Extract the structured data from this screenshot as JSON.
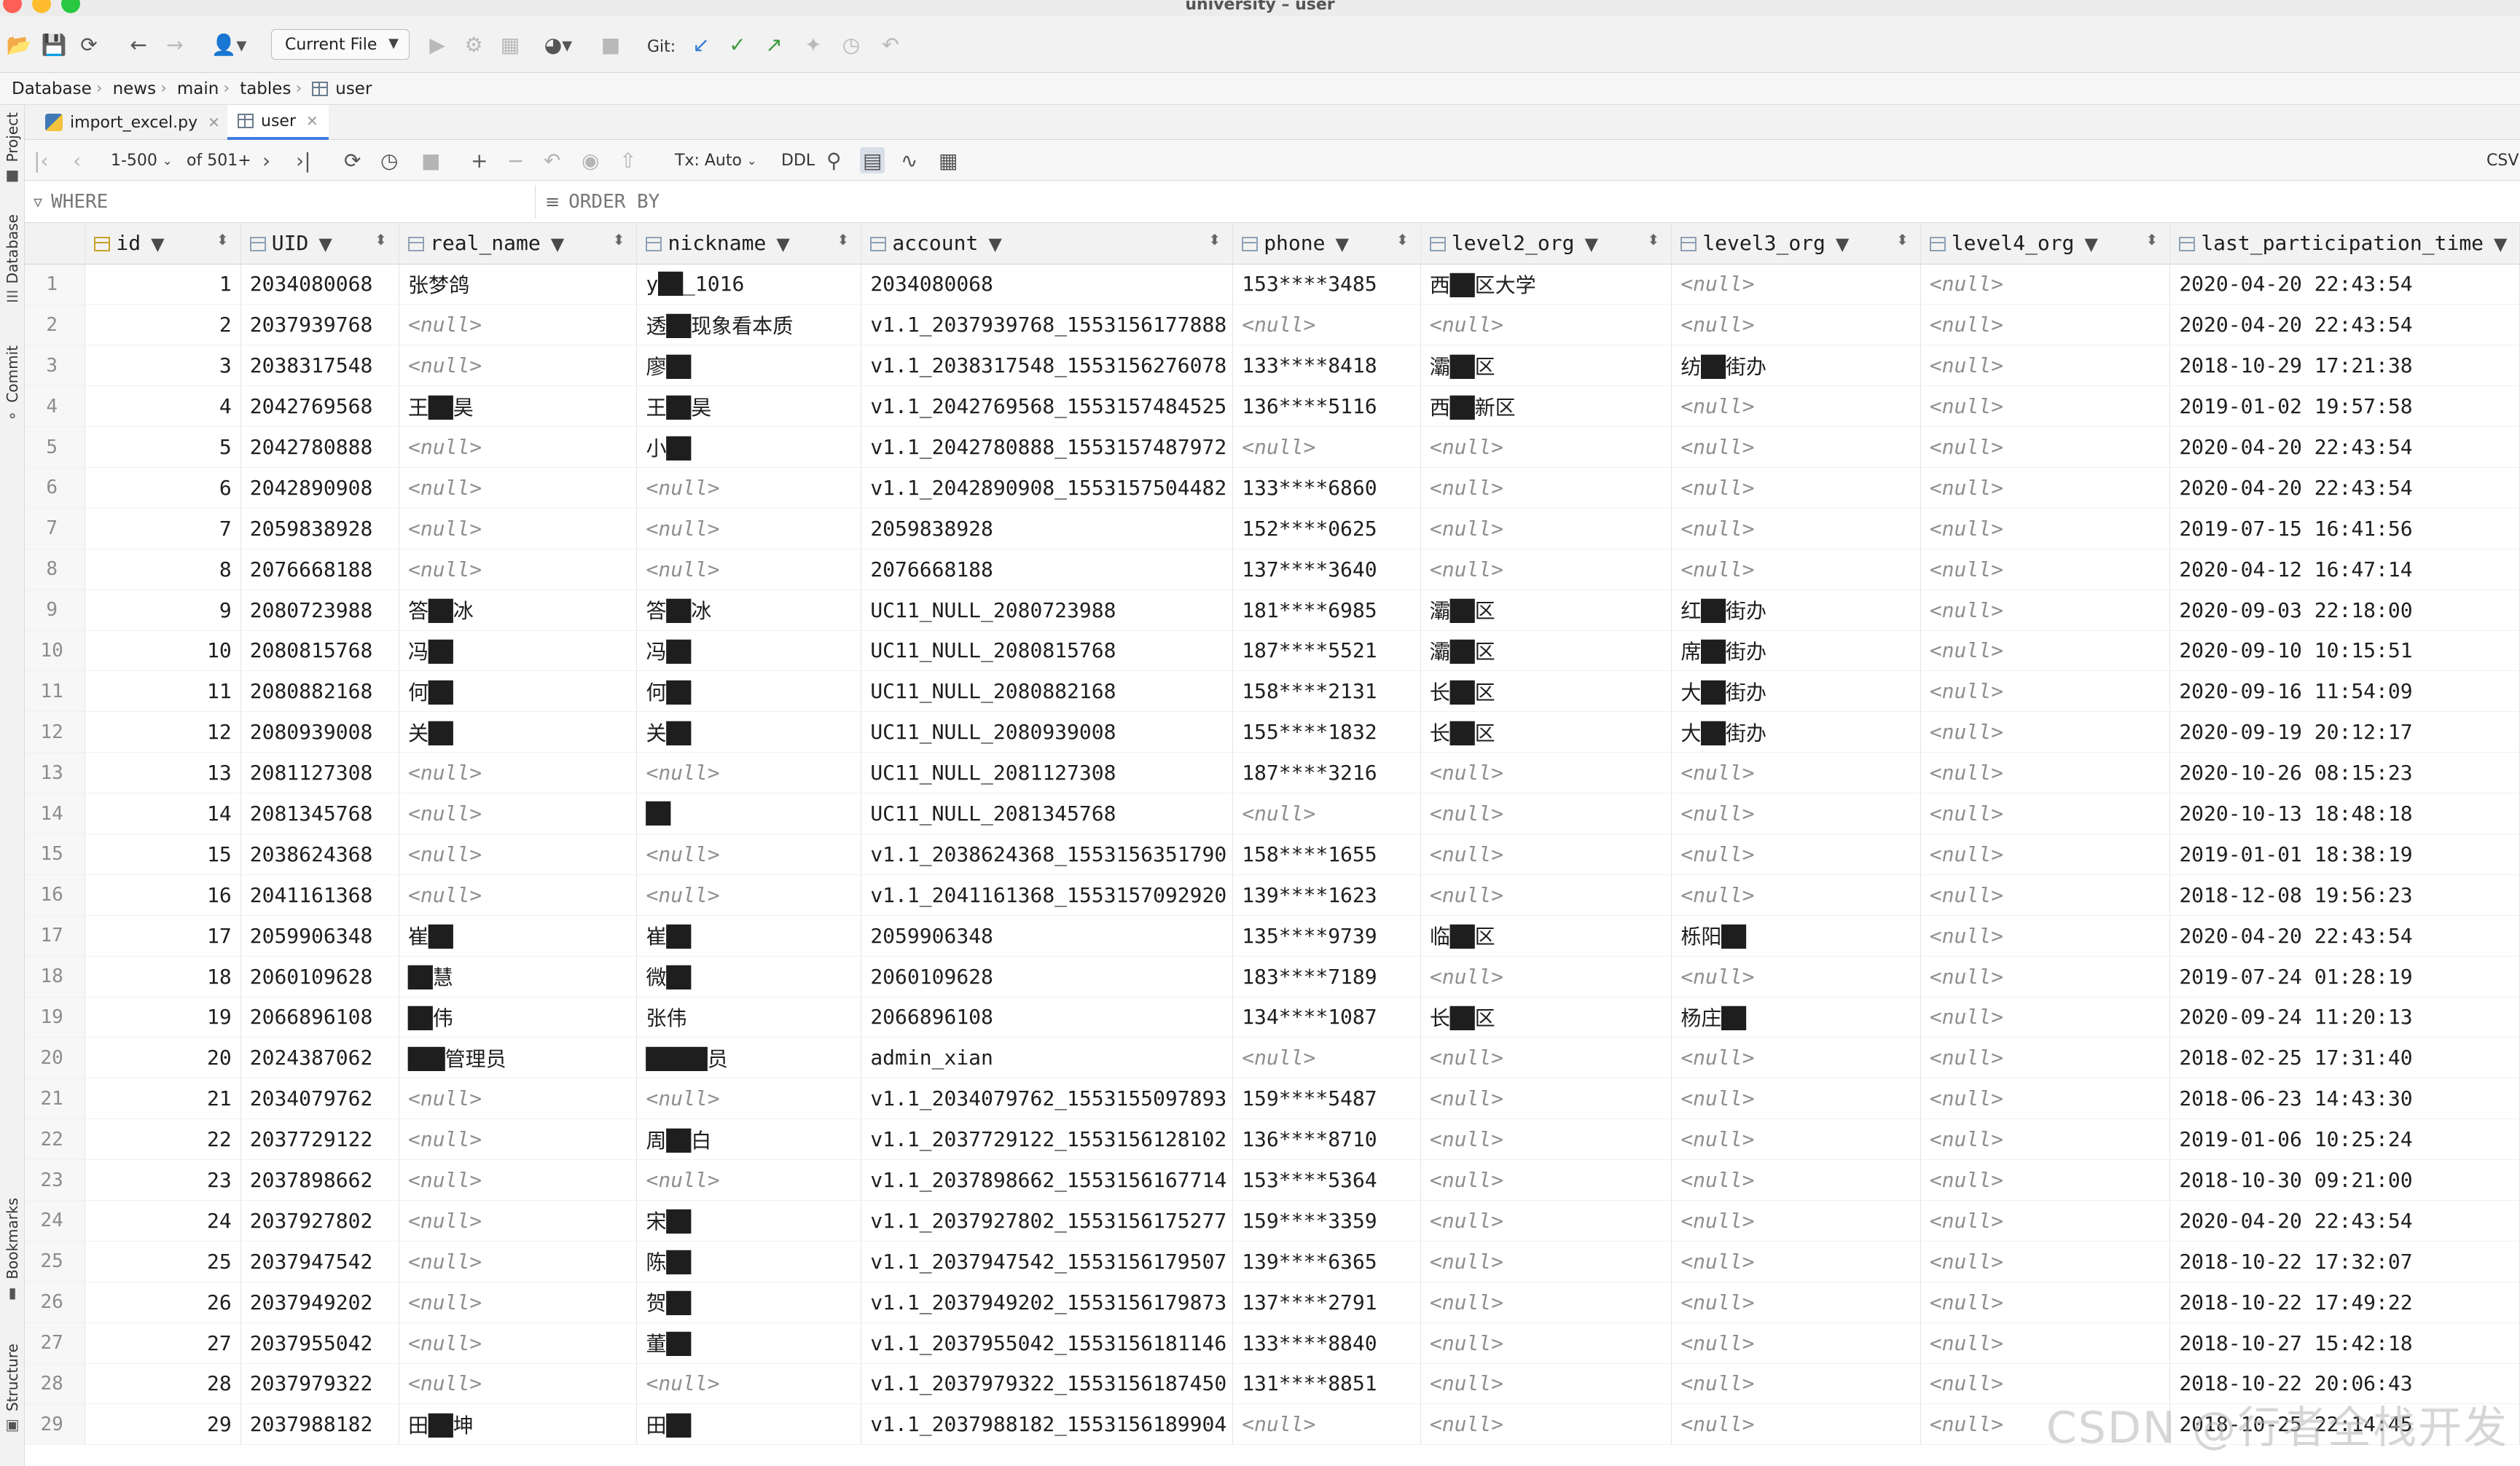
{
  "window": {
    "title": "university – user",
    "traffic_colors": [
      "#fe5f57",
      "#febc2e",
      "#28c840"
    ]
  },
  "toolbar": {
    "run_config": "Current File",
    "git_label": "Git:",
    "icons": [
      "open-folder-icon",
      "save-icon",
      "sync-icon",
      "back-icon",
      "forward-icon",
      "user-icon",
      "run-icon",
      "debug-icon",
      "coverage-icon",
      "profile-icon",
      "stop-icon",
      "git-update-icon",
      "git-commit-icon",
      "git-push-icon",
      "git-branches-icon",
      "git-history-icon",
      "git-rollback-icon"
    ]
  },
  "breadcrumb": [
    "Database",
    "news",
    "main",
    "tables",
    "user"
  ],
  "left_stripe": [
    "Project",
    "Database",
    "Commit",
    "Bookmarks",
    "Structure"
  ],
  "file_tabs": [
    {
      "label": "import_excel.py",
      "active": false
    },
    {
      "label": "user",
      "active": true
    }
  ],
  "grid_toolbar": {
    "range": "1-500",
    "of_total": "of 501+",
    "tx_mode": "Tx: Auto",
    "ddl": "DDL",
    "export": "CSV"
  },
  "filter": {
    "where_label": "WHERE",
    "order_label": "ORDER BY"
  },
  "columns": [
    "id",
    "UID",
    "real_name",
    "nickname",
    "account",
    "phone",
    "level2_org",
    "level3_org",
    "level4_org",
    "last_participation_time"
  ],
  "rows": [
    [
      "1",
      "2034080068",
      "张梦鸽",
      "y██_1016",
      "2034080068",
      "153****3485",
      "西██区大学",
      "<null>",
      "<null>",
      "2020-04-20 22:43:54"
    ],
    [
      "2",
      "2037939768",
      "<null>",
      "透██现象看本质",
      "v1.1_2037939768_1553156177888",
      "<null>",
      "<null>",
      "<null>",
      "<null>",
      "2020-04-20 22:43:54"
    ],
    [
      "3",
      "2038317548",
      "<null>",
      "廖██",
      "v1.1_2038317548_1553156276078",
      "133****8418",
      "灞██区",
      "纺██街办",
      "<null>",
      "2018-10-29 17:21:38"
    ],
    [
      "4",
      "2042769568",
      "王██昊",
      "王██昊",
      "v1.1_2042769568_1553157484525",
      "136****5116",
      "西██新区",
      "<null>",
      "<null>",
      "2019-01-02 19:57:58"
    ],
    [
      "5",
      "2042780888",
      "<null>",
      "小██",
      "v1.1_2042780888_1553157487972",
      "<null>",
      "<null>",
      "<null>",
      "<null>",
      "2020-04-20 22:43:54"
    ],
    [
      "6",
      "2042890908",
      "<null>",
      "<null>",
      "v1.1_2042890908_1553157504482",
      "133****6860",
      "<null>",
      "<null>",
      "<null>",
      "2020-04-20 22:43:54"
    ],
    [
      "7",
      "2059838928",
      "<null>",
      "<null>",
      "2059838928",
      "152****0625",
      "<null>",
      "<null>",
      "<null>",
      "2019-07-15 16:41:56"
    ],
    [
      "8",
      "2076668188",
      "<null>",
      "<null>",
      "2076668188",
      "137****3640",
      "<null>",
      "<null>",
      "<null>",
      "2020-04-12 16:47:14"
    ],
    [
      "9",
      "2080723988",
      "答██冰",
      "答██冰",
      "UC11_NULL_2080723988",
      "181****6985",
      "灞██区",
      "红██街办",
      "<null>",
      "2020-09-03 22:18:00"
    ],
    [
      "10",
      "2080815768",
      "冯██",
      "冯██",
      "UC11_NULL_2080815768",
      "187****5521",
      "灞██区",
      "席██街办",
      "<null>",
      "2020-09-10 10:15:51"
    ],
    [
      "11",
      "2080882168",
      "何██",
      "何██",
      "UC11_NULL_2080882168",
      "158****2131",
      "长██区",
      "大██街办",
      "<null>",
      "2020-09-16 11:54:09"
    ],
    [
      "12",
      "2080939008",
      "关██",
      "关██",
      "UC11_NULL_2080939008",
      "155****1832",
      "长██区",
      "大██街办",
      "<null>",
      "2020-09-19 20:12:17"
    ],
    [
      "13",
      "2081127308",
      "<null>",
      "<null>",
      "UC11_NULL_2081127308",
      "187****3216",
      "<null>",
      "<null>",
      "<null>",
      "2020-10-26 08:15:23"
    ],
    [
      "14",
      "2081345768",
      "<null>",
      "██",
      "UC11_NULL_2081345768",
      "<null>",
      "<null>",
      "<null>",
      "<null>",
      "2020-10-13 18:48:18"
    ],
    [
      "15",
      "2038624368",
      "<null>",
      "<null>",
      "v1.1_2038624368_1553156351790",
      "158****1655",
      "<null>",
      "<null>",
      "<null>",
      "2019-01-01 18:38:19"
    ],
    [
      "16",
      "2041161368",
      "<null>",
      "<null>",
      "v1.1_2041161368_1553157092920",
      "139****1623",
      "<null>",
      "<null>",
      "<null>",
      "2018-12-08 19:56:23"
    ],
    [
      "17",
      "2059906348",
      "崔██",
      "崔██",
      "2059906348",
      "135****9739",
      "临██区",
      "栎阳██",
      "<null>",
      "2020-04-20 22:43:54"
    ],
    [
      "18",
      "2060109628",
      "██慧",
      "微██",
      "2060109628",
      "183****7189",
      "<null>",
      "<null>",
      "<null>",
      "2019-07-24 01:28:19"
    ],
    [
      "19",
      "2066896108",
      "██伟",
      "张伟",
      "2066896108",
      "134****1087",
      "长██区",
      "杨庄██",
      "<null>",
      "2020-09-24 11:20:13"
    ],
    [
      "20",
      "2024387062",
      "███管理员",
      "█████员",
      "admin_xian",
      "<null>",
      "<null>",
      "<null>",
      "<null>",
      "2018-02-25 17:31:40"
    ],
    [
      "21",
      "2034079762",
      "<null>",
      "<null>",
      "v1.1_2034079762_1553155097893",
      "159****5487",
      "<null>",
      "<null>",
      "<null>",
      "2018-06-23 14:43:30"
    ],
    [
      "22",
      "2037729122",
      "<null>",
      "周██白",
      "v1.1_2037729122_1553156128102",
      "136****8710",
      "<null>",
      "<null>",
      "<null>",
      "2019-01-06 10:25:24"
    ],
    [
      "23",
      "2037898662",
      "<null>",
      "<null>",
      "v1.1_2037898662_1553156167714",
      "153****5364",
      "<null>",
      "<null>",
      "<null>",
      "2018-10-30 09:21:00"
    ],
    [
      "24",
      "2037927802",
      "<null>",
      "宋██",
      "v1.1_2037927802_1553156175277",
      "159****3359",
      "<null>",
      "<null>",
      "<null>",
      "2020-04-20 22:43:54"
    ],
    [
      "25",
      "2037947542",
      "<null>",
      "陈██",
      "v1.1_2037947542_1553156179507",
      "139****6365",
      "<null>",
      "<null>",
      "<null>",
      "2018-10-22 17:32:07"
    ],
    [
      "26",
      "2037949202",
      "<null>",
      "贺██",
      "v1.1_2037949202_1553156179873",
      "137****2791",
      "<null>",
      "<null>",
      "<null>",
      "2018-10-22 17:49:22"
    ],
    [
      "27",
      "2037955042",
      "<null>",
      "董██",
      "v1.1_2037955042_1553156181146",
      "133****8840",
      "<null>",
      "<null>",
      "<null>",
      "2018-10-27 15:42:18"
    ],
    [
      "28",
      "2037979322",
      "<null>",
      "<null>",
      "v1.1_2037979322_1553156187450",
      "131****8851",
      "<null>",
      "<null>",
      "<null>",
      "2018-10-22 20:06:43"
    ],
    [
      "29",
      "2037988182",
      "田██坤",
      "田██",
      "v1.1_2037988182_1553156189904",
      "<null>",
      "<null>",
      "<null>",
      "<null>",
      "2018-10-25 22:14:45"
    ]
  ],
  "watermark": "CSDN @行者全栈开发"
}
